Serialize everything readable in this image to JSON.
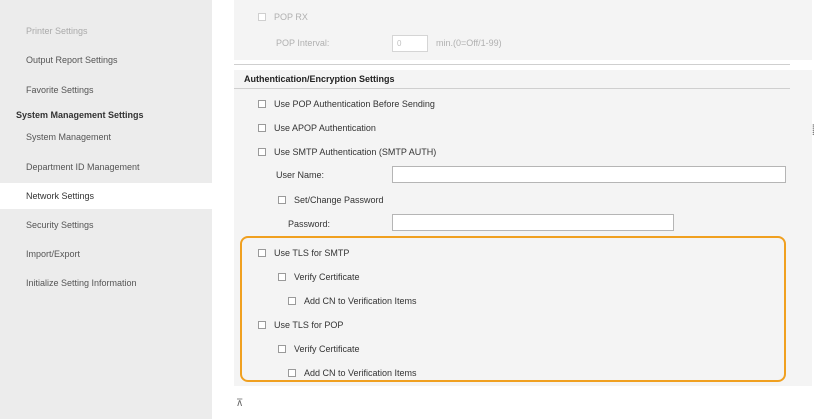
{
  "sidebar": {
    "items": [
      {
        "label": "Printer Settings"
      },
      {
        "label": "Output Report Settings"
      },
      {
        "label": "Favorite Settings"
      },
      {
        "label": "System Management"
      },
      {
        "label": "Department ID Management"
      },
      {
        "label": "Network Settings"
      },
      {
        "label": "Security Settings"
      },
      {
        "label": "Import/Export"
      },
      {
        "label": "Initialize Setting Information"
      }
    ],
    "heading": "System Management Settings",
    "selected": "Network Settings"
  },
  "top_panel": {
    "pop_rx_label": "POP RX",
    "pop_interval_label": "POP Interval:",
    "pop_interval_value": "0",
    "pop_interval_unit": "min.(0=Off/1-99)"
  },
  "auth": {
    "title": "Authentication/Encryption Settings",
    "use_pop_auth": "Use POP Authentication Before Sending",
    "use_apop": "Use APOP Authentication",
    "use_smtp_auth": "Use SMTP Authentication (SMTP AUTH)",
    "user_name_label": "User Name:",
    "set_change_password": "Set/Change Password",
    "password_label": "Password:",
    "use_tls_smtp": "Use TLS for SMTP",
    "verify_certificate_smtp": "Verify Certificate",
    "add_cn_smtp": "Add CN to Verification Items",
    "use_tls_pop": "Use TLS for POP",
    "verify_certificate_pop": "Verify Certificate",
    "add_cn_pop": "Add CN to Verification Items"
  },
  "colors": {
    "highlight": "#f0a020",
    "sidebar_bg": "#ececec"
  },
  "icons": {
    "scroll_mark": "double-bar-icon",
    "page_top": "page-top-icon"
  },
  "glyphs": {
    "scroll_mark": "⸽",
    "page_top": "⊼"
  }
}
